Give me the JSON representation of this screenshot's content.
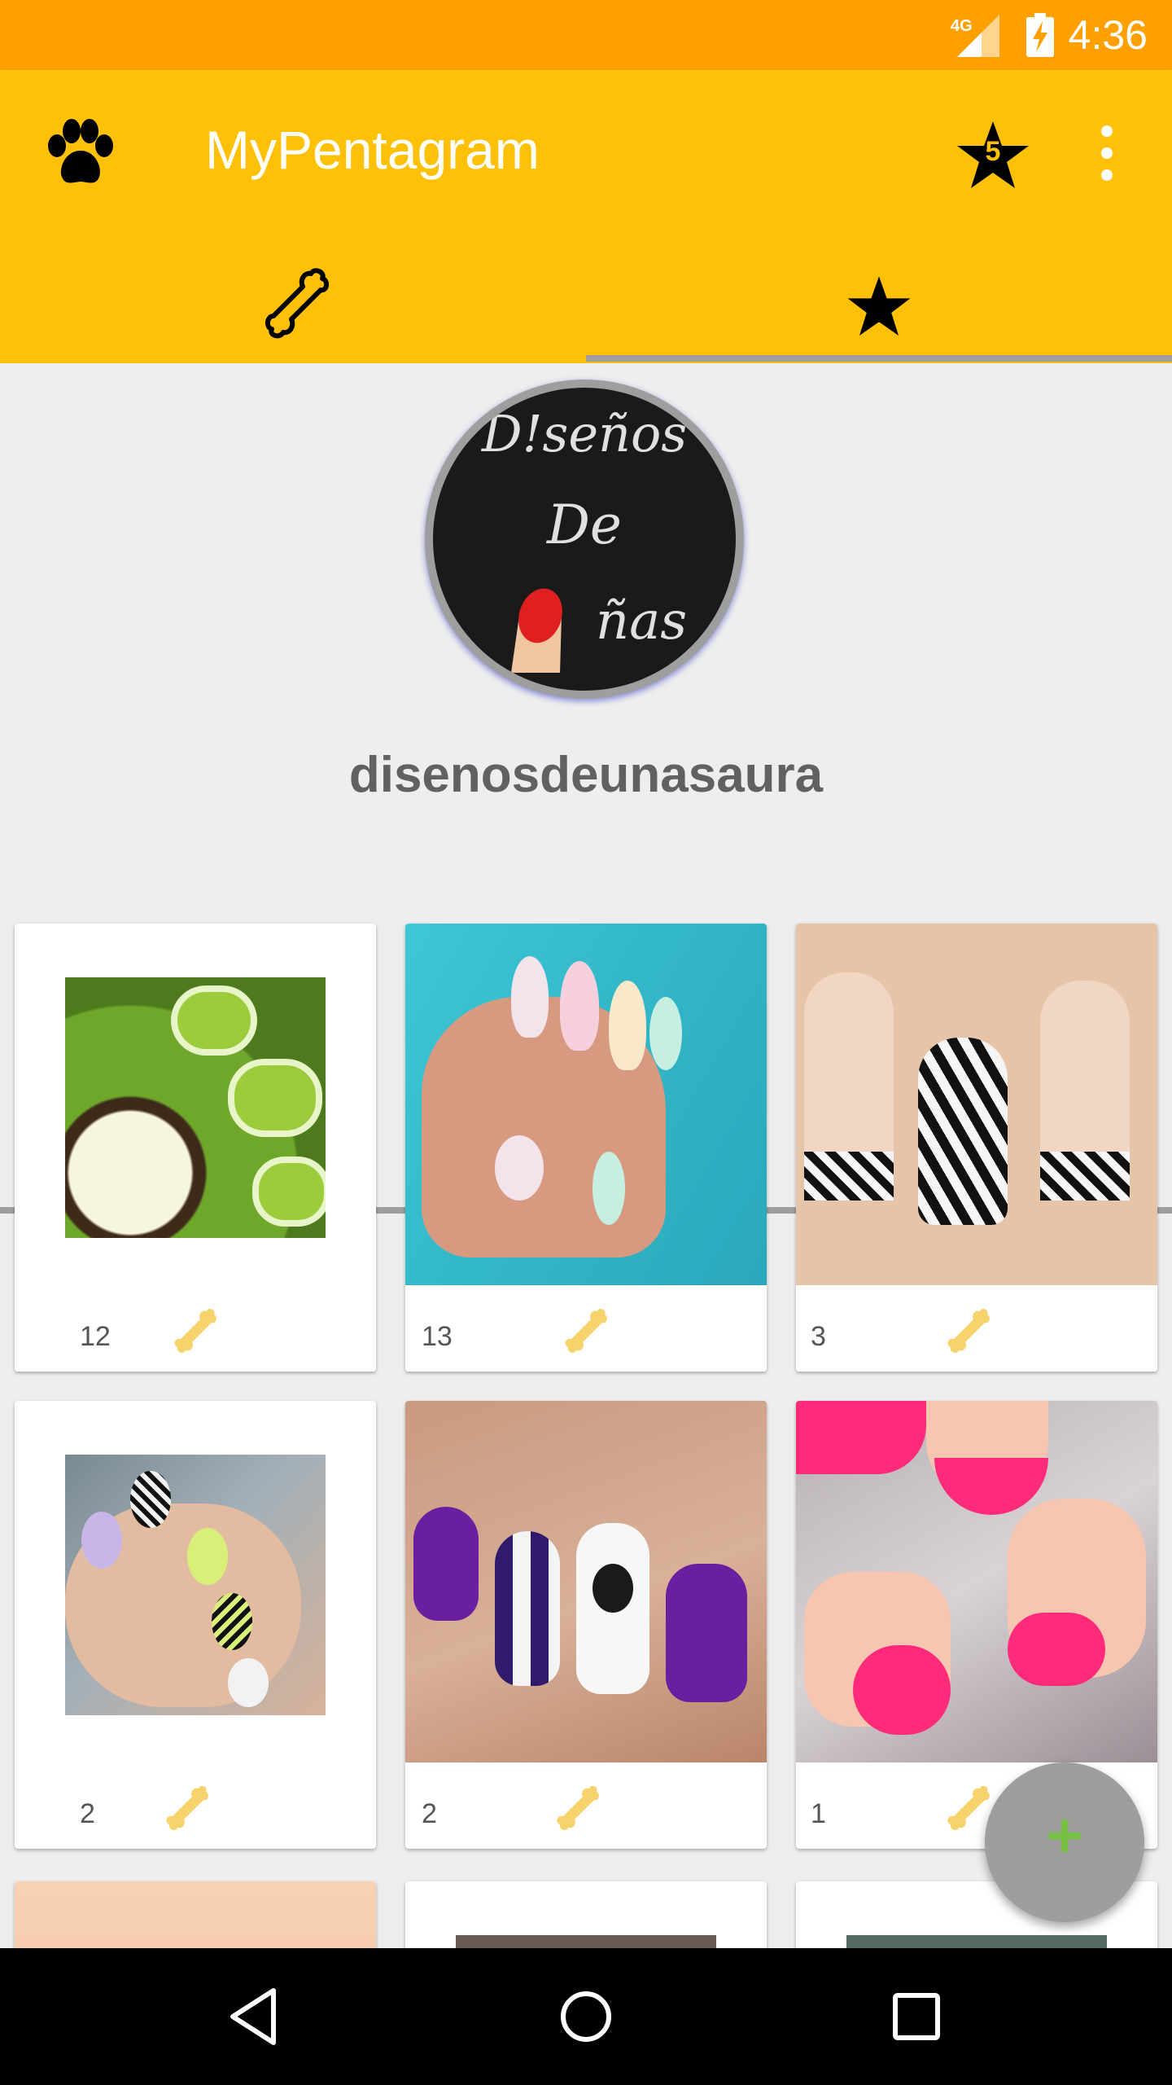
{
  "status_bar": {
    "time": "4:36",
    "network": "4G"
  },
  "app_bar": {
    "title": "MyPentagram",
    "favorites_count": "5"
  },
  "tabs": [
    {
      "name": "bone-tab",
      "icon": "bone-icon"
    },
    {
      "name": "favorites-tab",
      "icon": "star-icon"
    }
  ],
  "profile": {
    "username": "disenosdeunasaura",
    "avatar_text": [
      "D!seños",
      "De",
      "ñas"
    ]
  },
  "posts": [
    {
      "likes": "12"
    },
    {
      "likes": "13"
    },
    {
      "likes": "3"
    },
    {
      "likes": "2"
    },
    {
      "likes": "2"
    },
    {
      "likes": "1"
    }
  ],
  "fab": {
    "label": "+"
  },
  "colors": {
    "accent": "#ffc107",
    "status": "#ffa000",
    "fab_icon": "#76c043",
    "bone": "#f6d36b"
  }
}
